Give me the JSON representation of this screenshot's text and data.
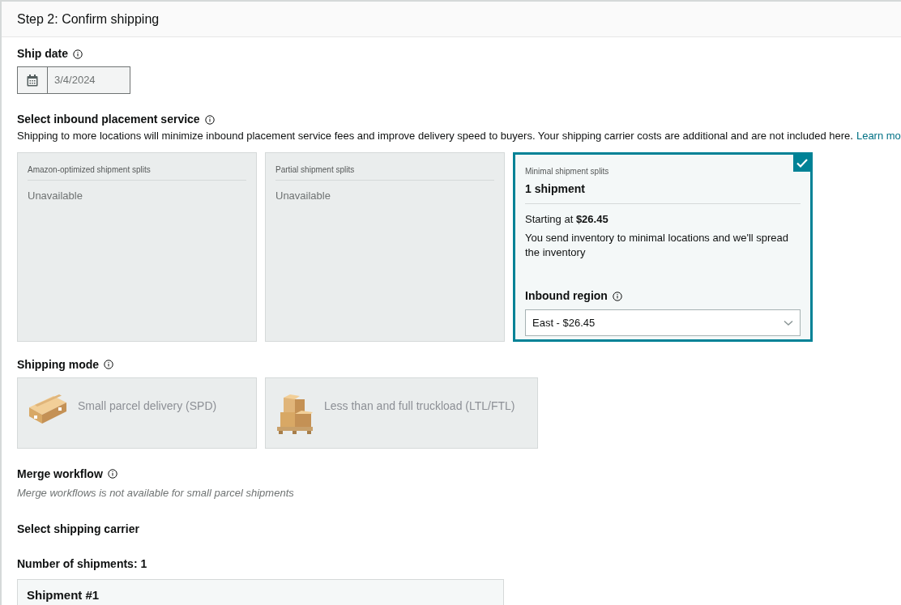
{
  "header": {
    "title": "Step 2: Confirm shipping"
  },
  "ship_date": {
    "label": "Ship date",
    "value": "3/4/2024",
    "disabled": true
  },
  "placement": {
    "label": "Select inbound placement service",
    "description": "Shipping to more locations will minimize inbound placement service fees and improve delivery speed to buyers. Your shipping carrier costs are additional and are not included here.",
    "link": "Learn mo",
    "options": [
      {
        "kind": "unavailable",
        "title": "Amazon-optimized shipment splits",
        "status": "Unavailable",
        "selected": false
      },
      {
        "kind": "unavailable",
        "title": "Partial shipment splits",
        "status": "Unavailable",
        "selected": false
      },
      {
        "kind": "available",
        "title": "Minimal shipment splits",
        "count": "1 shipment",
        "price": "Starting at **$26.45**",
        "description": "You send inventory to minimal locations and we'll spread the inventory",
        "region_label": "Inbound region",
        "region_value": "East - $26.45",
        "selected": true
      }
    ]
  },
  "shipping_mode": {
    "label": "Shipping mode",
    "options": [
      {
        "kind": "parcel",
        "label": "Small parcel delivery (SPD)",
        "selected": false,
        "disabled": true
      },
      {
        "kind": "pallet",
        "label": "Less than and full truckload (LTL/FTL)",
        "selected": false,
        "disabled": true
      }
    ]
  },
  "merge_workflow": {
    "label": "Merge workflow",
    "note": "Merge workflows is not available for small parcel shipments"
  },
  "carrier": {
    "label": "Select shipping carrier"
  },
  "shipments": {
    "label": "Number of shipments: 1",
    "items": [
      {
        "title": "Shipment #1"
      }
    ]
  }
}
